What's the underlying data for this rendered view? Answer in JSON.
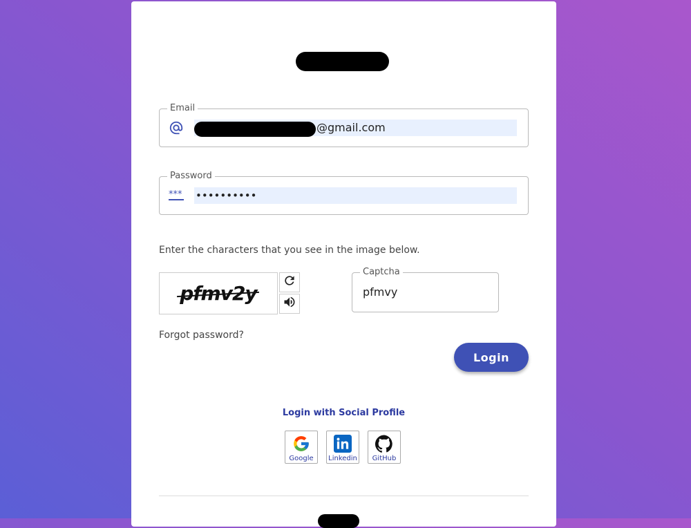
{
  "email": {
    "label": "Email",
    "value_suffix": "@gmail.com"
  },
  "password": {
    "label": "Password",
    "masked_value": "••••••••••",
    "icon_text": "***"
  },
  "captcha": {
    "prompt": "Enter the characters that you see in the image below.",
    "image_text": "pfmv2y",
    "field_label": "Captcha",
    "value": "pfmvy"
  },
  "links": {
    "forgot_password": "Forgot password?"
  },
  "login_button": "Login",
  "social": {
    "heading": "Login with Social Profile",
    "providers": [
      {
        "name": "Google",
        "label": "Google"
      },
      {
        "name": "Linkedin",
        "label": "Linkedin"
      },
      {
        "name": "GitHub",
        "label": "GitHub"
      }
    ]
  },
  "colors": {
    "accent": "#3f51b5",
    "link": "#2c3aa0",
    "autofill": "#e8f0fe"
  }
}
